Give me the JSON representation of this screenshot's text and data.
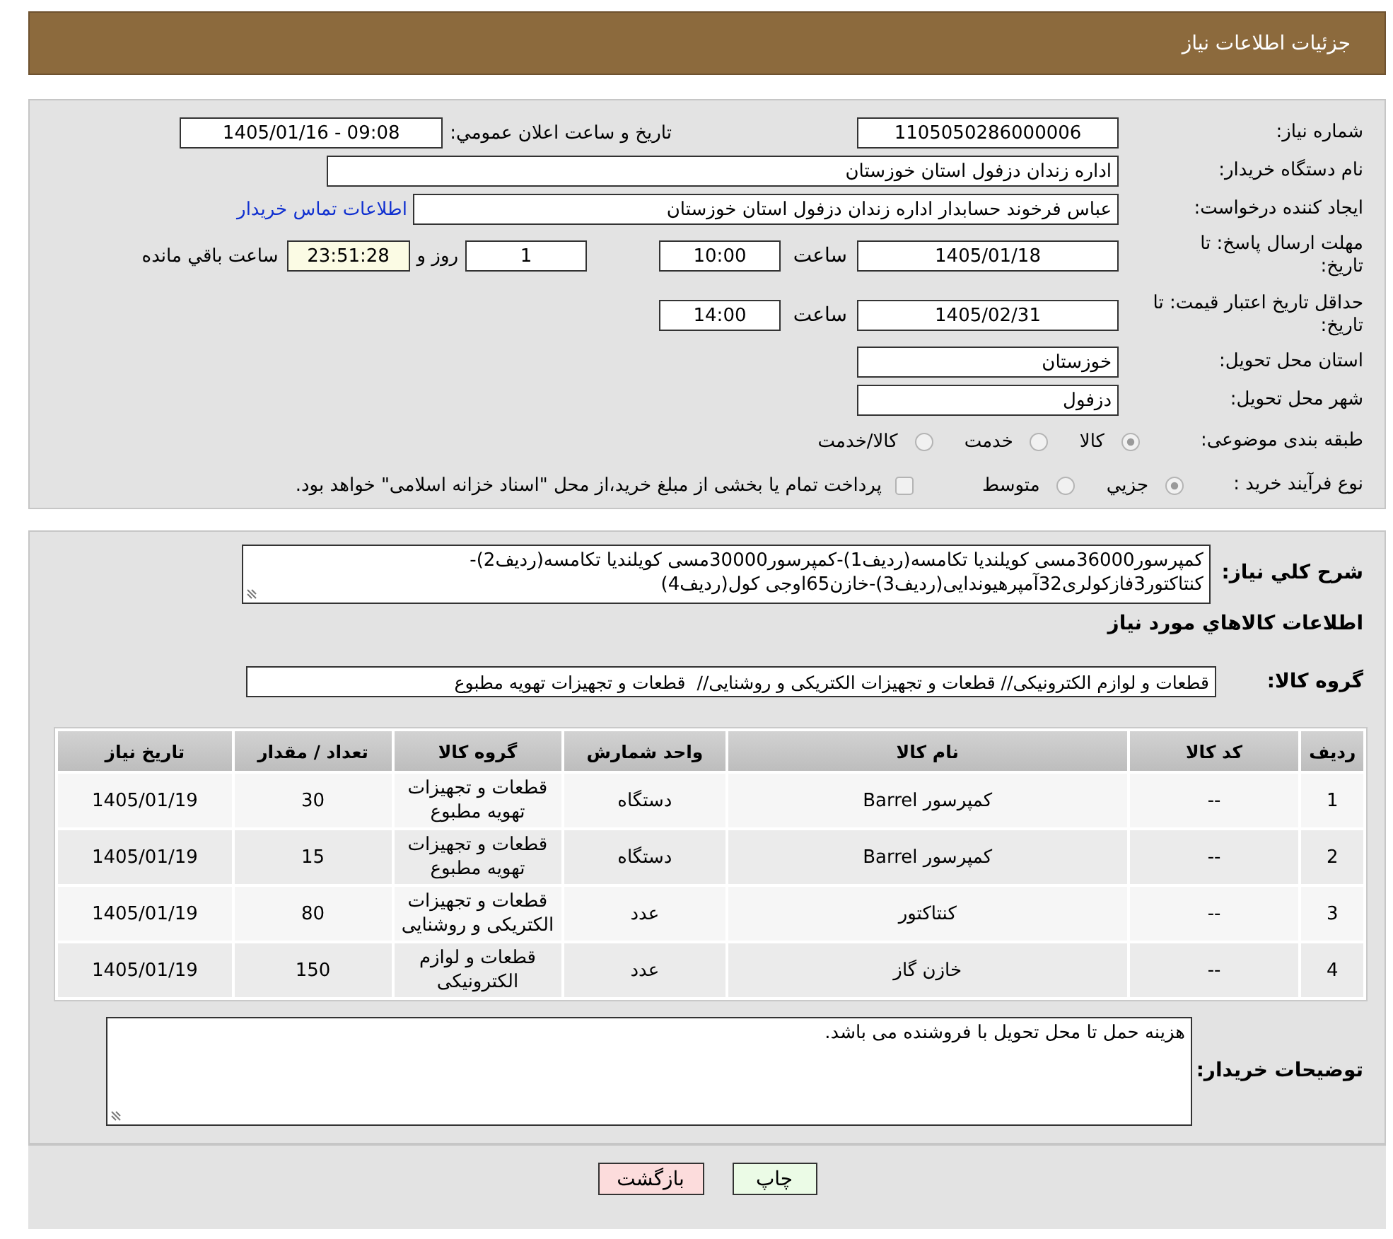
{
  "header": {
    "title": "جزئیات اطلاعات نیاز"
  },
  "details": {
    "need_number": {
      "label": "شماره نیاز:",
      "value": "1105050286000006"
    },
    "announcement": {
      "label": "تاریخ و ساعت اعلان عمومي:",
      "value": "1405/01/16 - 09:08"
    },
    "buyer_org": {
      "label": "نام دستگاه خریدار:",
      "value": "اداره زندان دزفول استان خوزستان"
    },
    "requester": {
      "label": "ایجاد کننده درخواست:",
      "value": "عباس فرخوند حسابدار اداره زندان دزفول استان خوزستان",
      "link": "اطلاعات تماس خریدار"
    },
    "response_deadline": {
      "label": "مهلت ارسال پاسخ: تا تاریخ:",
      "date": "1405/01/18",
      "time_label": "ساعت",
      "time": "10:00",
      "days": "1",
      "days_label": "روز و",
      "remaining": "23:51:28",
      "remaining_label": "ساعت باقي مانده"
    },
    "price_validity": {
      "label": "حداقل تاریخ اعتبار قیمت: تا تاریخ:",
      "date": "1405/02/31",
      "time_label": "ساعت",
      "time": "14:00"
    },
    "province": {
      "label": "استان محل تحویل:",
      "value": "خوزستان"
    },
    "city": {
      "label": "شهر محل تحویل:",
      "value": "دزفول"
    },
    "category": {
      "label": "طبقه بندی موضوعی:",
      "disabled": true,
      "options": [
        {
          "label": "کالا",
          "selected": true
        },
        {
          "label": "خدمت",
          "selected": false
        },
        {
          "label": "کالا/خدمت",
          "selected": false
        }
      ]
    },
    "purchase_type": {
      "label": "نوع فرآیند خرید :",
      "disabled": true,
      "options": [
        {
          "label": "جزيي",
          "selected": true
        },
        {
          "label": "متوسط",
          "selected": false
        }
      ],
      "treasury": {
        "label": "پرداخت تمام يا بخشی از مبلغ خرید،از محل \"اسناد خزانه اسلامی\" خواهد بود.",
        "checked": false
      }
    }
  },
  "description": {
    "label": "شرح کلي نیاز:",
    "text": "کمپرسور36000مسی کویلندیا تکامسه(ردیف1)-کمپرسور30000مسی کویلندیا تکامسه(ردیف2)-کنتاکتور3فازکولری32آمپرهیوندایی(ردیف3)-خازن65اوجی کول(ردیف4)"
  },
  "goods": {
    "title": "اطلاعات کالاهاي مورد نیاز",
    "group_label": "گروه کالا:",
    "group_value": "قطعات و لوازم الکترونیکی// قطعات و تجهیزات الکتریکی و روشنایی//  قطعات و تجهیزات تهویه مطبوع",
    "table": {
      "columns": [
        "ردیف",
        "کد کالا",
        "نام کالا",
        "واحد شمارش",
        "گروه کالا",
        "تعداد / مقدار",
        "تاریخ نیاز"
      ],
      "rows": [
        [
          "1",
          "--",
          "کمپرسور Barrel",
          "دستگاه",
          "قطعات و تجهیزات تهویه مطبوع",
          "30",
          "1405/01/19"
        ],
        [
          "2",
          "--",
          "کمپرسور Barrel",
          "دستگاه",
          "قطعات و تجهیزات تهویه مطبوع",
          "15",
          "1405/01/19"
        ],
        [
          "3",
          "--",
          "کنتاکتور",
          "عدد",
          "قطعات و تجهیزات الکتریکی و روشنایی",
          "80",
          "1405/01/19"
        ],
        [
          "4",
          "--",
          "خازن گاز",
          "عدد",
          "قطعات و لوازم الکترونیکی",
          "150",
          "1405/01/19"
        ]
      ]
    }
  },
  "buyer_notes": {
    "label": "توضیحات خریدار:",
    "text": "هزینه حمل تا محل تحویل با فروشنده می باشد."
  },
  "buttons": [
    {
      "label": "چاپ",
      "kind": "print"
    },
    {
      "label": "بازگشت",
      "kind": "back"
    }
  ]
}
